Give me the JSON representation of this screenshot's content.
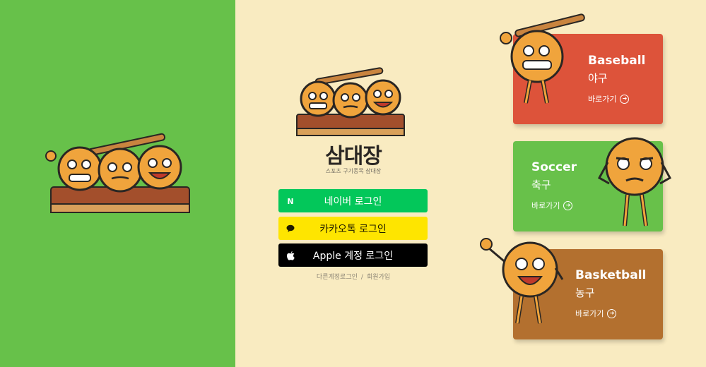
{
  "brand": {
    "logo_text": "삼대장",
    "tagline": "스포츠 구기종목 삼대장"
  },
  "login": {
    "naver_label": "네이버 로그인",
    "naver_icon": "N",
    "kakao_label": "카카오톡 로그인",
    "apple_label": "Apple 계정 로그인",
    "other_account_label": "다른계정로그인",
    "separator": "/",
    "signup_label": "회원가입"
  },
  "sports": [
    {
      "title": "Baseball",
      "subtitle": "야구",
      "link_label": "바로가기"
    },
    {
      "title": "Soccer",
      "subtitle": "축구",
      "link_label": "바로가기"
    },
    {
      "title": "Basketball",
      "subtitle": "농구",
      "link_label": "바로가기"
    }
  ],
  "icons": {
    "go": "➜"
  },
  "colors": {
    "green": "#67c14a",
    "cream": "#f9ebc1",
    "baseball": "#dd533a",
    "soccer": "#68c14a",
    "basketball": "#b3702f",
    "naver": "#03c75a",
    "kakao": "#fee500",
    "apple": "#000000",
    "mascot_orange": "#f0a43c"
  }
}
